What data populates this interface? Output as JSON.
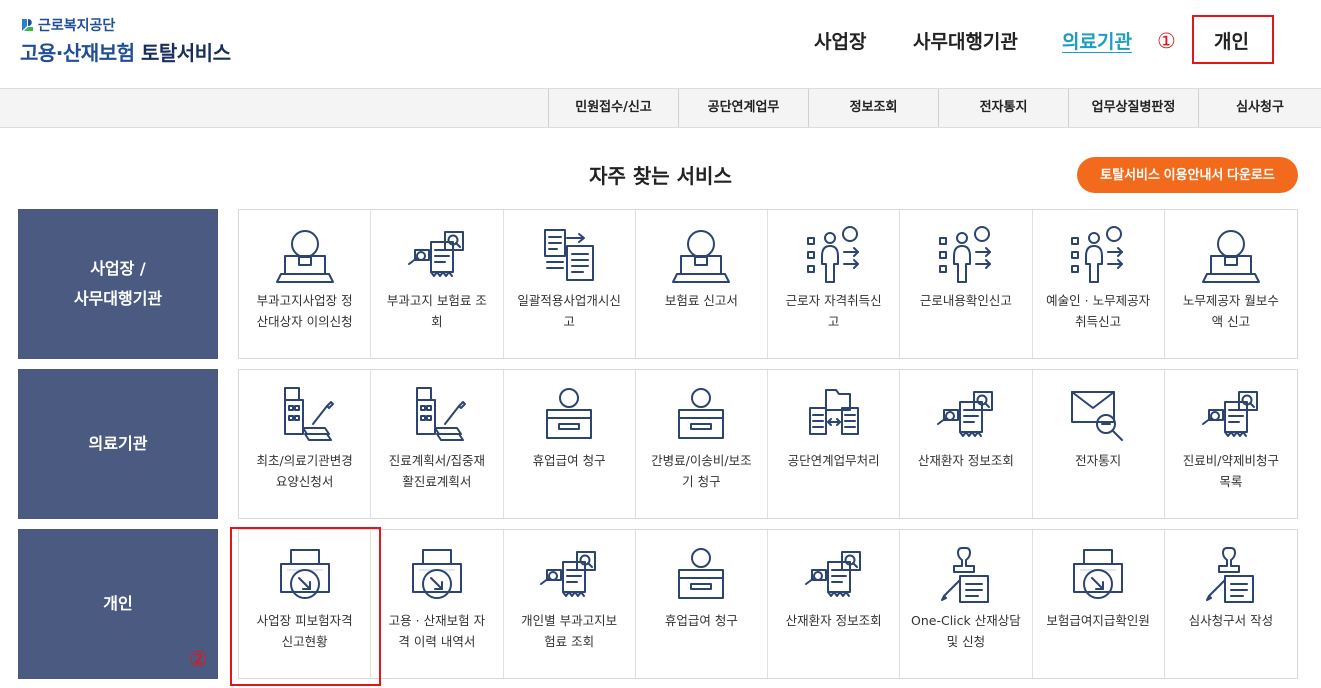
{
  "logo": {
    "org": "근로복지공단",
    "title_main": "고용·산재보험 ",
    "title_strong": "토탈서비스"
  },
  "top_nav": [
    {
      "label": "사업장",
      "active": false
    },
    {
      "label": "사무대행기관",
      "active": false
    },
    {
      "label": "의료기관",
      "active": true
    },
    {
      "label": "개인",
      "active": false
    }
  ],
  "annotations": {
    "step1": "①",
    "step2": "②",
    "color": "#e2161a"
  },
  "sub_nav": [
    "민원접수/신고",
    "공단연계업무",
    "정보조회",
    "전자통지",
    "업무상질병판정",
    "심사청구"
  ],
  "section_title": "자주 찾는 서비스",
  "guide_button": "토탈서비스 이용안내서 다운로드",
  "colors": {
    "brand": "#1f4e96",
    "accent_teal": "#1c9ec0",
    "orange": "#f26a1b",
    "row_label_bg": "#4b5a80"
  },
  "rows": [
    {
      "label_lines": [
        "사업장 /",
        "사무대행기관"
      ],
      "tiles": [
        {
          "icon": "money-bulb-laptop-icon",
          "lines": [
            "부과고지사업장 정",
            "산대상자 이의신청"
          ]
        },
        {
          "icon": "search-document-icon",
          "lines": [
            "부과고지 보험료 조",
            "회"
          ]
        },
        {
          "icon": "document-transfer-icon",
          "lines": [
            "일괄적용사업개시신",
            "고"
          ]
        },
        {
          "icon": "money-bulb-laptop-icon",
          "lines": [
            "보험료 신고서"
          ]
        },
        {
          "icon": "worker-list-icon",
          "lines": [
            "근로자 자격취득신",
            "고"
          ]
        },
        {
          "icon": "worker-list-icon",
          "lines": [
            "근로내용확인신고"
          ]
        },
        {
          "icon": "worker-list-icon",
          "lines": [
            "예술인 · 노무제공자",
            "취득신고"
          ]
        },
        {
          "icon": "money-bulb-laptop-icon",
          "lines": [
            "노무제공자 월보수",
            "액 신고"
          ]
        }
      ]
    },
    {
      "label_lines": [
        "의료기관"
      ],
      "tiles": [
        {
          "icon": "hospital-document-icon",
          "lines": [
            "최초/의료기관변경",
            "요양신청서"
          ]
        },
        {
          "icon": "hospital-document-icon",
          "lines": [
            "진료계획서/집중재",
            "활진료계획서"
          ]
        },
        {
          "icon": "money-box-icon",
          "lines": [
            "휴업급여 청구"
          ]
        },
        {
          "icon": "money-box-icon",
          "lines": [
            "간병료/이송비/보조",
            "기 청구"
          ]
        },
        {
          "icon": "folder-exchange-icon",
          "lines": [
            "공단연계업무처리"
          ]
        },
        {
          "icon": "search-document-icon",
          "lines": [
            "산재환자 정보조회"
          ]
        },
        {
          "icon": "mail-search-icon",
          "lines": [
            "전자통지"
          ]
        },
        {
          "icon": "search-document-icon",
          "lines": [
            "진료비/약제비청구",
            "목록"
          ]
        }
      ]
    },
    {
      "label_lines": [
        "개인"
      ],
      "tiles": [
        {
          "icon": "printer-download-icon",
          "lines": [
            "사업장 피보험자격",
            "신고현황"
          ]
        },
        {
          "icon": "printer-download-icon",
          "lines": [
            "고용 · 산재보험 자",
            "격 이력 내역서"
          ]
        },
        {
          "icon": "search-document-icon",
          "lines": [
            "개인별 부과고지보",
            "험료 조회"
          ]
        },
        {
          "icon": "money-box-icon",
          "lines": [
            "휴업급여 청구"
          ]
        },
        {
          "icon": "search-document-icon",
          "lines": [
            "산재환자 정보조회"
          ]
        },
        {
          "icon": "stamp-document-icon",
          "lines": [
            "One-Click 산재상담",
            "및 신청"
          ]
        },
        {
          "icon": "printer-download-icon",
          "lines": [
            "보험급여지급확인원"
          ]
        },
        {
          "icon": "stamp-document-icon",
          "lines": [
            "심사청구서 작성"
          ]
        }
      ]
    }
  ]
}
